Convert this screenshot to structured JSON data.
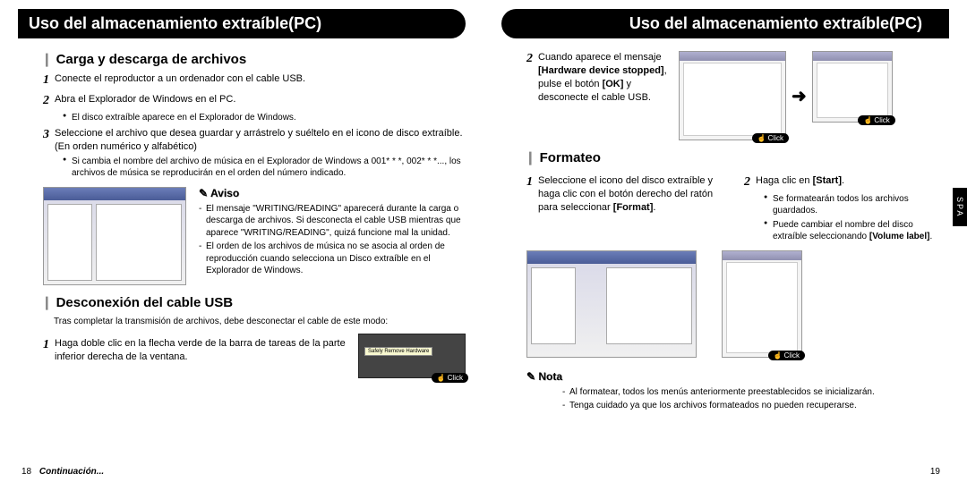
{
  "left": {
    "header": "Uso del almacenamiento extraíble(PC)",
    "section1": {
      "title": "Carga y descarga de archivos",
      "step1": "Conecte el reproductor a un ordenador con el cable USB.",
      "step2": "Abra el Explorador de Windows en el PC.",
      "bullet2a": "El disco extraíble aparece en el Explorador de Windows.",
      "step3": "Seleccione el archivo que desea guardar y arrástrelo y suéltelo en el icono de disco extraíble. (En orden numérico y alfabético)",
      "bullet3a": "Si cambia el nombre del archivo de música en el Explorador de Windows a 001* * *, 002* * *..., los archivos de música se reproducirán en el orden del número indicado.",
      "aviso_title": "Aviso",
      "aviso1": "El mensaje \"WRITING/READING\" aparecerá durante la carga o descarga de archivos. Si desconecta el cable USB mientras que aparece \"WRITING/READING\", quizá funcione mal la unidad.",
      "aviso2": "El orden de los archivos de música no se asocia al orden de reproducción cuando selecciona un Disco extraíble en el Explorador de Windows."
    },
    "section2": {
      "title": "Desconexión del cable USB",
      "intro": "Tras completar la transmisión de archivos, debe desconectar el cable de este modo:",
      "step1": "Haga doble clic en la flecha verde de la barra de tareas de la parte inferior derecha de la ventana.",
      "tray_tooltip": "Safely Remove Hardware",
      "click": "Click"
    },
    "page_num": "18",
    "continuation": "Continuación..."
  },
  "right": {
    "header": "Uso del almacenamiento extraíble(PC)",
    "step2_pre": "Cuando aparece el mensaje ",
    "step2_bold1": "[Hardware device stopped]",
    "step2_mid": ", pulse el botón ",
    "step2_bold2": "[OK]",
    "step2_post": " y desconecte el cable USB.",
    "click": "Click",
    "section_format": {
      "title": "Formateo",
      "step1_pre": "Seleccione el icono del disco extraíble y haga clic con el botón derecho del ratón para selec­cionar ",
      "step1_bold": "[Format]",
      "step1_post": ".",
      "step2_pre": "Haga clic en ",
      "step2_bold": "[Start]",
      "step2_post": ".",
      "bullet2a": "Se formatearán todos los archivos guardados.",
      "bullet2b_pre": "Puede cambiar el nombre del disco extraíble seleccionando ",
      "bullet2b_bold": "[Volume label]",
      "bullet2b_post": "."
    },
    "nota": {
      "title": "Nota",
      "n1": "Al formatear, todos los menús anteriormente preestablecidos se inicializarán.",
      "n2": "Tenga cuidado ya que los archivos formateados no pueden recuperarse."
    },
    "spa": "SPA",
    "page_num": "19"
  }
}
